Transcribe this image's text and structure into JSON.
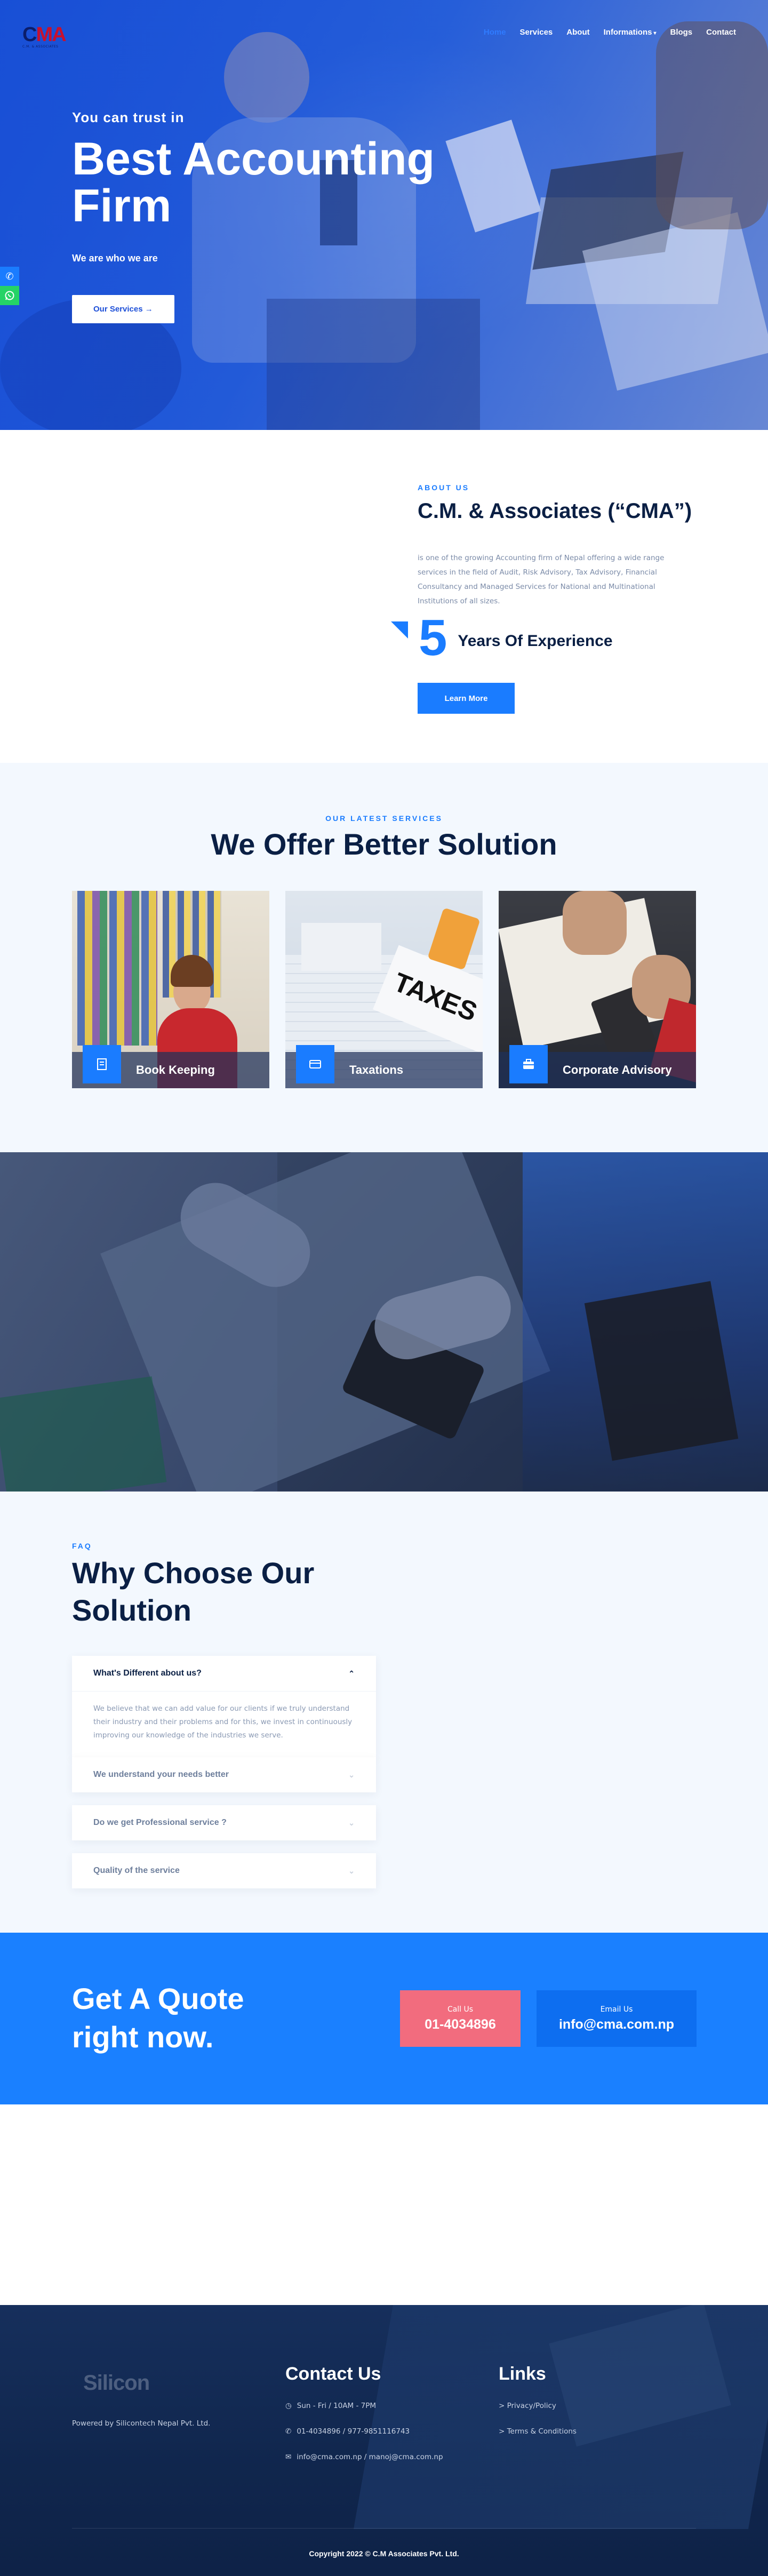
{
  "brand": {
    "logo_text": "CMA",
    "logo_tagline": "C.M. & ASSOCIATES"
  },
  "nav": {
    "items": [
      {
        "label": "Home",
        "active": true
      },
      {
        "label": "Services",
        "active": false
      },
      {
        "label": "About",
        "active": false
      },
      {
        "label": "Informations",
        "active": false,
        "has_caret": true
      },
      {
        "label": "Blogs",
        "active": false
      },
      {
        "label": "Contact",
        "active": false
      }
    ]
  },
  "hero": {
    "kicker": "You can trust in",
    "title": "Best Accounting Firm",
    "subtitle": "We are who we are",
    "button": "Our Services →"
  },
  "side_icons": {
    "phone": "phone-icon",
    "whatsapp": "whatsapp-icon"
  },
  "about": {
    "kicker": "ABOUT US",
    "title": "C.M. & Associates (“CMA”)",
    "text": "is one of the growing Accounting firm of Nepal offering a wide range services in the field of Audit, Risk Advisory, Tax Advisory, Financial Consultancy and Managed Services for National and Multinational Institutions of all sizes.",
    "years": "5",
    "years_label": "Years Of Experience",
    "button": "Learn More"
  },
  "services": {
    "kicker": "OUR LATEST SERVICES",
    "title": "We Offer Better Solution",
    "cards": [
      {
        "label": "Book Keeping",
        "icon": "book-icon"
      },
      {
        "label": "Taxations",
        "icon": "card-icon"
      },
      {
        "label": "Corporate Advisory",
        "icon": "briefcase-icon"
      }
    ]
  },
  "faq": {
    "kicker": "FAQ",
    "title": "Why Choose Our Solution",
    "items": [
      {
        "question": "What's Different about us?",
        "answer": "We believe that we can add value for our clients if we truly understand their industry and their problems and for this, we invest in continuously improving our knowledge of the industries we serve.",
        "open": true
      },
      {
        "question": "We understand your needs better",
        "open": false
      },
      {
        "question": "Do we get Professional service ?",
        "open": false
      },
      {
        "question": "Quality of the service",
        "open": false
      }
    ]
  },
  "quote": {
    "title": "Get A Quote right now.",
    "call_label": "Call Us",
    "call_value": "01-4034896",
    "email_label": "Email Us",
    "email_value": "info@cma.com.np"
  },
  "footer": {
    "logo_text": "Silicon",
    "powered": "Powered by Silicontech Nepal Pvt. Ltd.",
    "contact_heading": "Contact Us",
    "contact_items": [
      {
        "icon": "clock-icon",
        "text": "Sun - Fri / 10AM - 7PM"
      },
      {
        "icon": "phone-icon",
        "text": "01-4034896 / 977-9851116743"
      },
      {
        "icon": "mail-icon",
        "text": "info@cma.com.np / manoj@cma.com.np"
      }
    ],
    "links_heading": "Links",
    "links": [
      "> Privacy/Policy",
      "> Terms & Conditions"
    ],
    "copyright": "Copyright 2022 © C.M Associates Pvt. Ltd."
  },
  "colors": {
    "primary": "#1a7cff",
    "navy": "#0a1f44",
    "call_box": "#f26c7e",
    "light_bg": "#f3f8fe"
  }
}
